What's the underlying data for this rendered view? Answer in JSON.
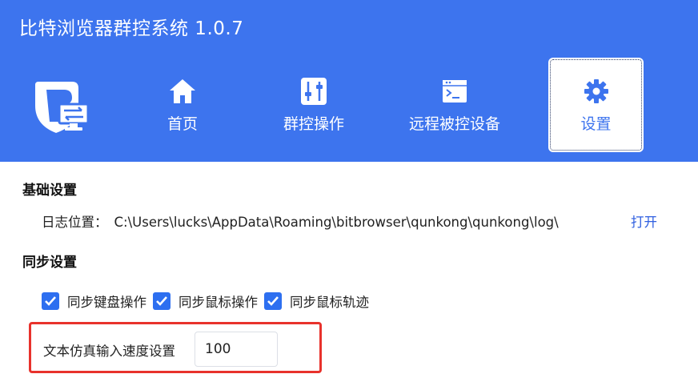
{
  "app": {
    "title": "比特浏览器群控系统 1.0.7"
  },
  "colors": {
    "header_bg": "#3d74ee",
    "link": "#2f5fe0",
    "checkbox": "#2d6ff0",
    "highlight_box": "#e8322c"
  },
  "nav": {
    "items": [
      {
        "label": "首页",
        "icon": "home-icon",
        "active": false
      },
      {
        "label": "群控操作",
        "icon": "sliders-icon",
        "active": false
      },
      {
        "label": "远程被控设备",
        "icon": "terminal-icon",
        "active": false
      },
      {
        "label": "设置",
        "icon": "gear-icon",
        "active": true
      }
    ]
  },
  "basic": {
    "title": "基础设置",
    "log_label": "日志位置：",
    "log_path": "C:\\Users\\lucks\\AppData\\Roaming\\bitbrowser\\qunkong\\qunkong\\log\\",
    "open_label": "打开"
  },
  "sync": {
    "title": "同步设置",
    "options": [
      {
        "label": "同步键盘操作",
        "checked": true
      },
      {
        "label": "同步鼠标操作",
        "checked": true
      },
      {
        "label": "同步鼠标轨迹",
        "checked": true
      }
    ],
    "speed_label": "文本仿真输入速度设置",
    "speed_value": "100"
  }
}
